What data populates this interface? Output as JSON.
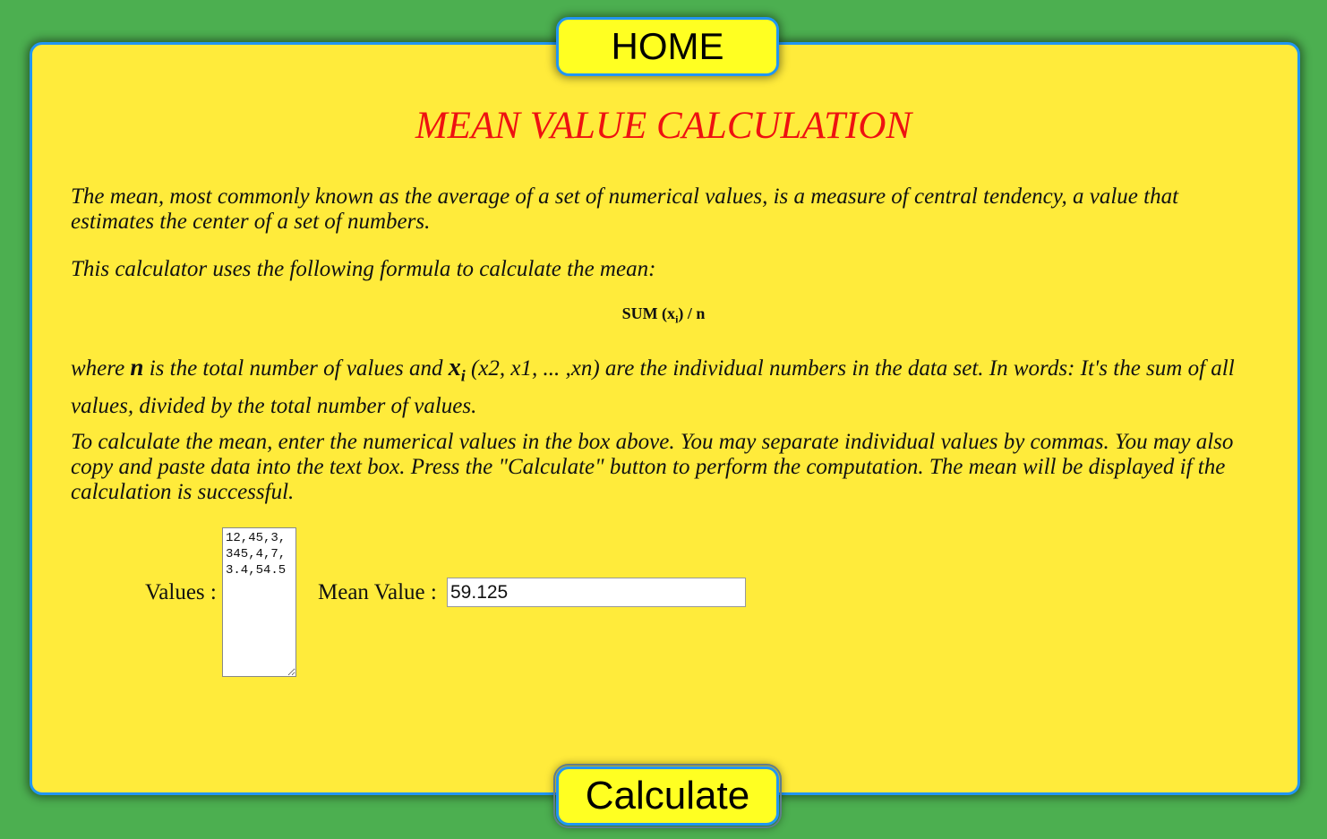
{
  "nav": {
    "home_label": "HOME"
  },
  "page": {
    "title": "MEAN VALUE CALCULATION",
    "intro": "The mean, most commonly known as the average of a set of numerical values, is a measure of central tendency, a value that estimates the center of a set of numbers.",
    "formula_intro": "This calculator uses the following formula to calculate the mean:",
    "formula": {
      "prefix": "SUM (x",
      "subscript": "i",
      "suffix": ") / n"
    },
    "explanation": {
      "part1": "where ",
      "n_symbol": "n",
      "part2": " is the total number of values and ",
      "x_symbol": "x",
      "x_subscript": "i",
      "part3": " (x2, x1, ... ,xn) are the individual numbers in the data set. In words: It's the sum of all values, divided by the total number of values."
    },
    "instructions": "To calculate the mean, enter the numerical values in the box above. You may separate individual values by commas. You may also copy and paste data into the text box. Press the \"Calculate\" button to perform the computation. The mean will be displayed if the calculation is successful."
  },
  "form": {
    "values_label": "Values :",
    "values_input": "12,45,3,345,4,7,3.4,54.5",
    "mean_label": "Mean Value :",
    "mean_output": "59.125",
    "calculate_label": "Calculate"
  },
  "colors": {
    "background": "#4caf50",
    "panel": "#ffeb3b",
    "border": "#2196f3",
    "title": "#ee1111",
    "button": "#ffff22"
  }
}
